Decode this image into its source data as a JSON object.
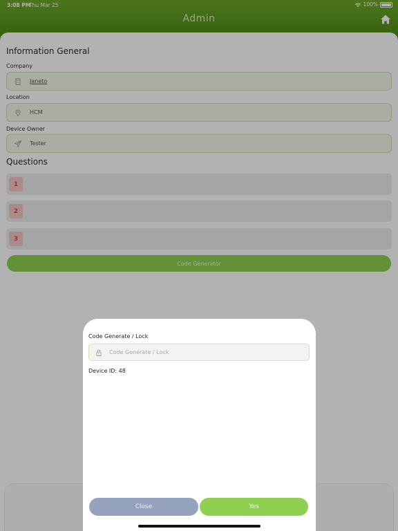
{
  "status_bar": {
    "time": "3:08 PM",
    "date": "Thu Mar 25",
    "battery": "100%"
  },
  "header": {
    "title": "Admin",
    "home_icon": "home-icon"
  },
  "info": {
    "section_title": "Information General",
    "company": {
      "label": "Company",
      "value": "Janeto",
      "icon": "building-icon"
    },
    "location": {
      "label": "Location",
      "value": "HCM",
      "icon": "location-pin-icon"
    },
    "device_owner": {
      "label": "Device Owner",
      "value": "Tester",
      "icon": "send-icon"
    }
  },
  "questions": {
    "section_title": "Questions",
    "items": [
      {
        "number": "1"
      },
      {
        "number": "2"
      },
      {
        "number": "3"
      }
    ]
  },
  "code_generator_label": "Code Generator",
  "modal": {
    "label": "Code Generate / Lock",
    "input_placeholder": "Code Generate / Lock",
    "input_value": "",
    "device_id": "Device ID: 48",
    "close_label": "Close",
    "yes_label": "Yes"
  },
  "colors": {
    "header": "#5f9a1f",
    "accent_green": "#8fd050",
    "close_button": "#95a3bf",
    "question_badge": "#f4c8c8"
  }
}
